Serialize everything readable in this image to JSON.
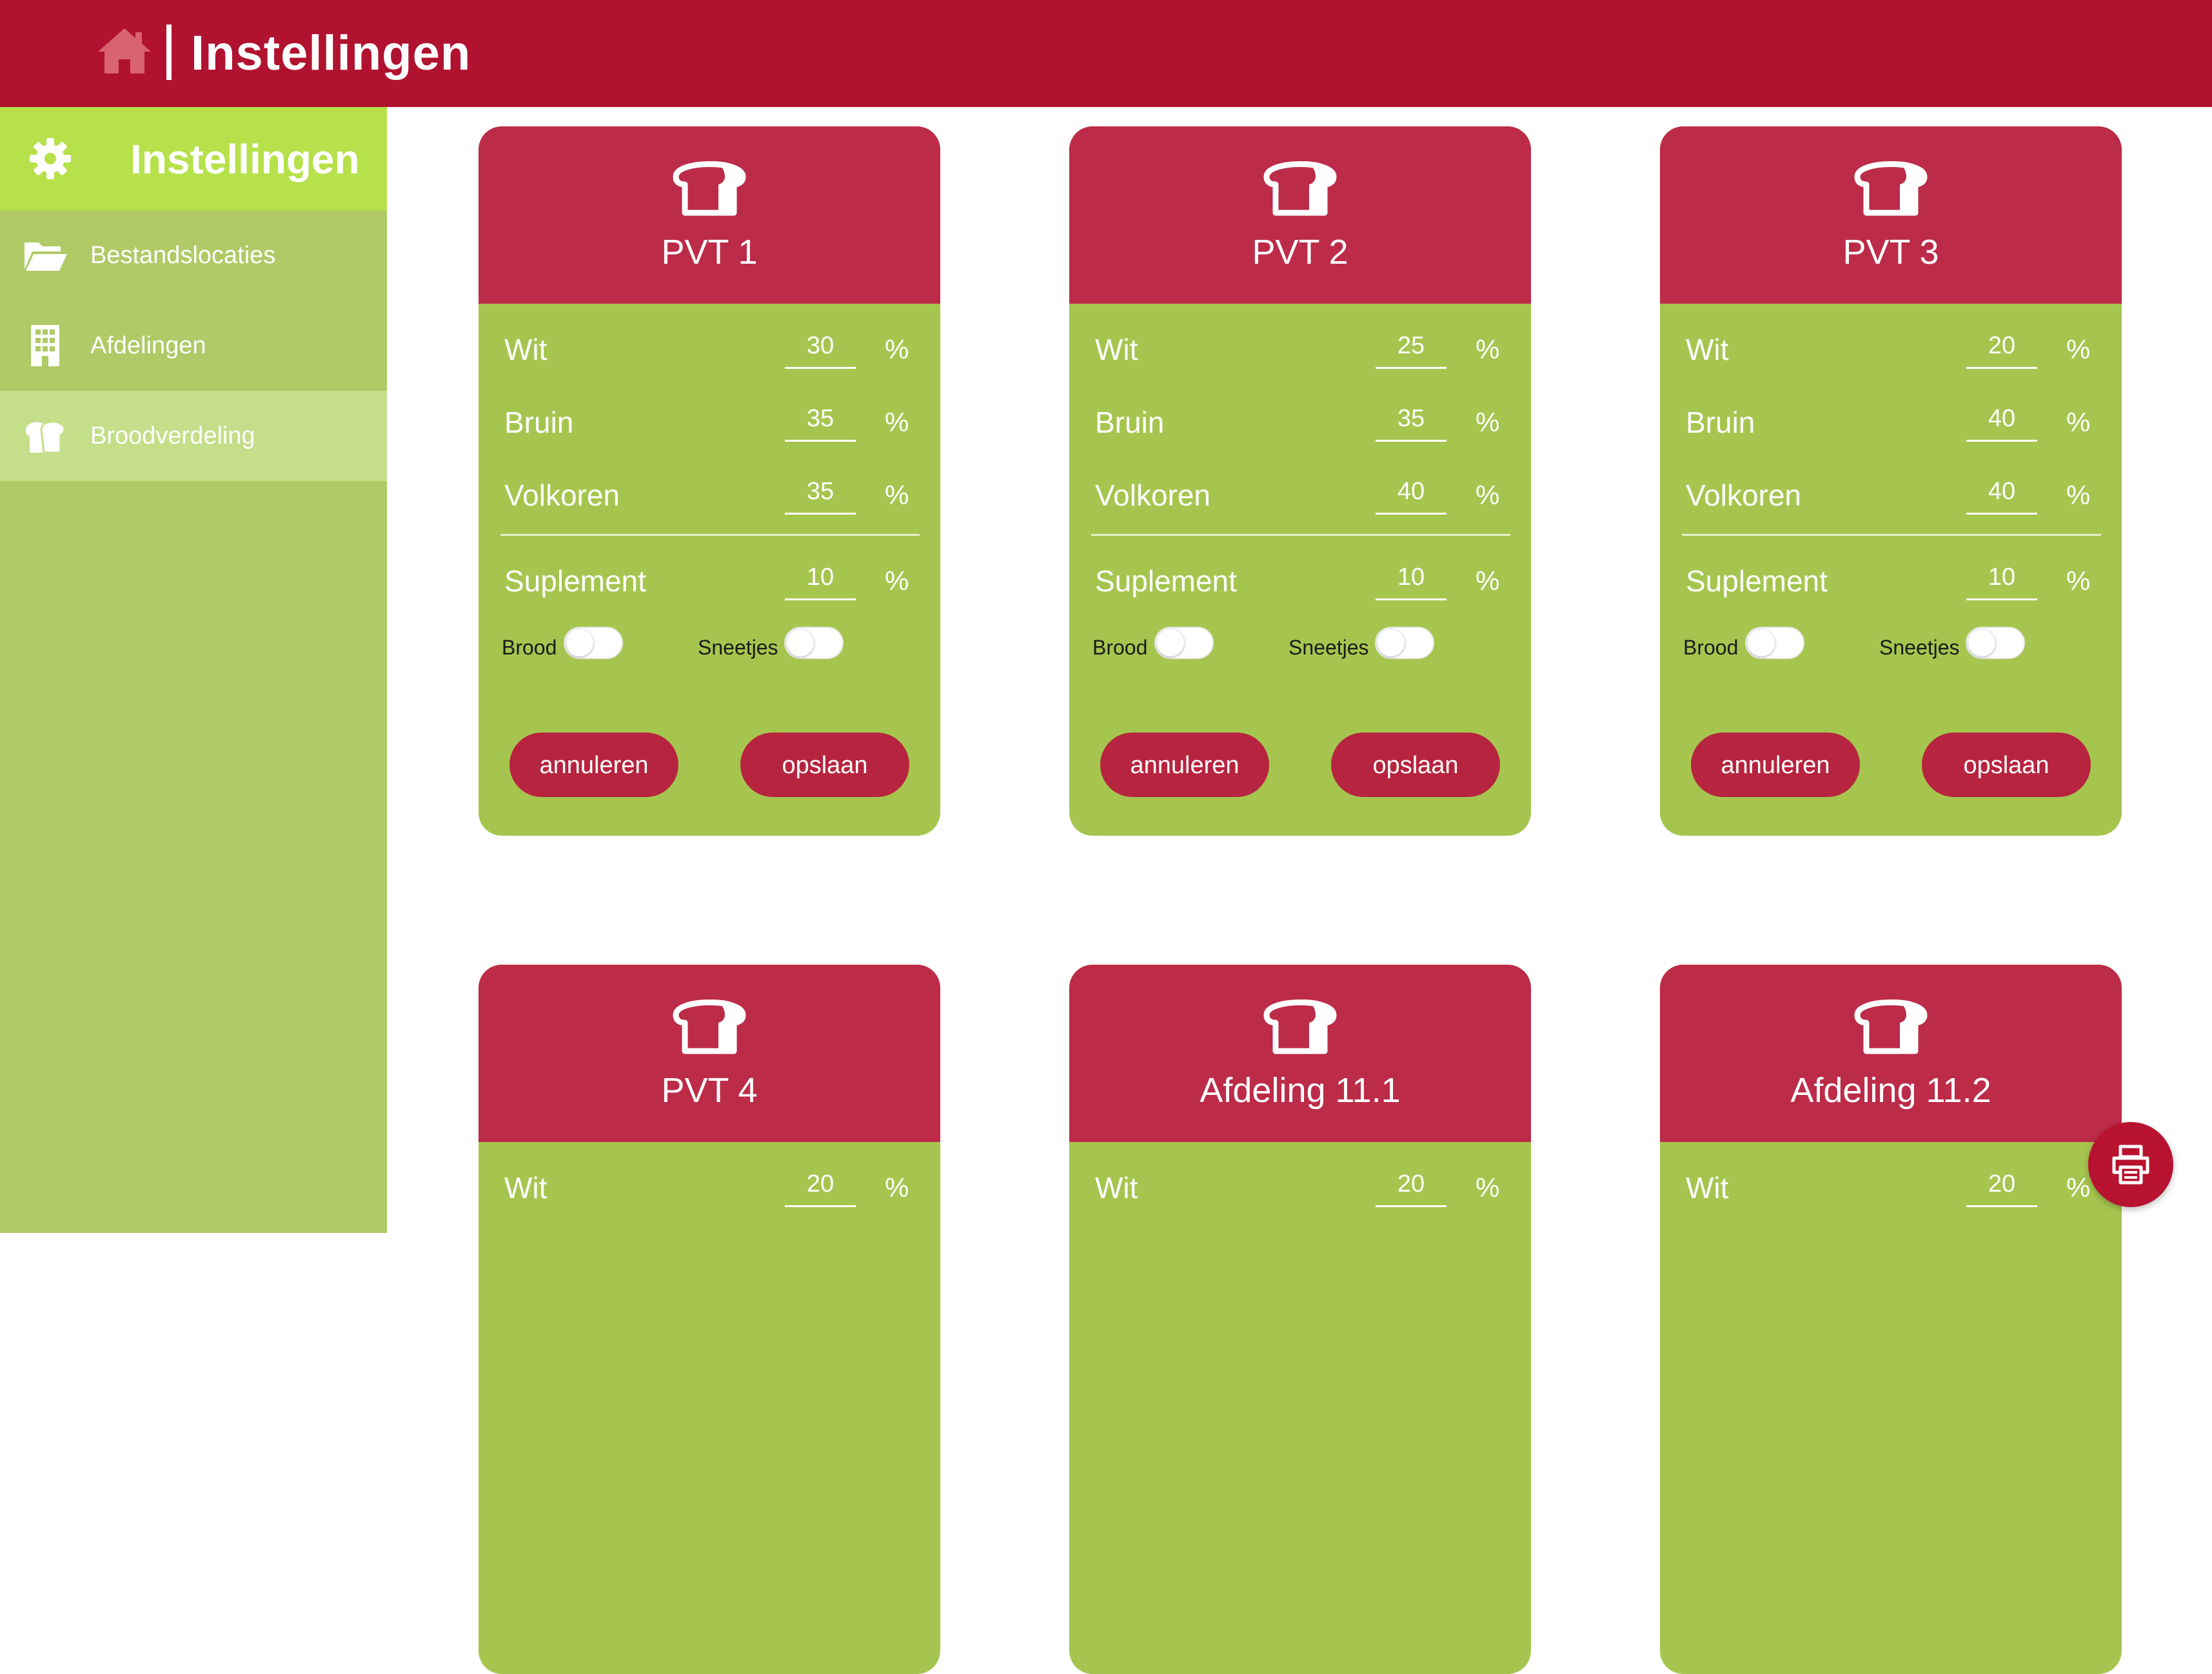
{
  "header": {
    "title": "Instellingen",
    "icon": "home-icon"
  },
  "sidebar": {
    "title": "Instellingen",
    "title_icon": "gear-icon",
    "items": [
      {
        "label": "Bestandslocaties",
        "icon": "folder-open-icon",
        "active": false
      },
      {
        "label": "Afdelingen",
        "icon": "building-icon",
        "active": false
      },
      {
        "label": "Broodverdeling",
        "icon": "bread-icon",
        "active": true
      }
    ]
  },
  "cards": [
    {
      "title": "PVT 1",
      "rows": [
        {
          "label": "Wit",
          "value": "30",
          "unit": "%"
        },
        {
          "label": "Bruin",
          "value": "35",
          "unit": "%"
        },
        {
          "label": "Volkoren",
          "value": "35",
          "unit": "%"
        },
        {
          "label": "Suplement",
          "value": "10",
          "unit": "%"
        }
      ],
      "toggles": [
        {
          "label": "Brood",
          "on": false
        },
        {
          "label": "Sneetjes",
          "on": false
        }
      ],
      "cancel_label": "annuleren",
      "save_label": "opslaan"
    },
    {
      "title": "PVT 2",
      "rows": [
        {
          "label": "Wit",
          "value": "25",
          "unit": "%"
        },
        {
          "label": "Bruin",
          "value": "35",
          "unit": "%"
        },
        {
          "label": "Volkoren",
          "value": "40",
          "unit": "%"
        },
        {
          "label": "Suplement",
          "value": "10",
          "unit": "%"
        }
      ],
      "toggles": [
        {
          "label": "Brood",
          "on": false
        },
        {
          "label": "Sneetjes",
          "on": false
        }
      ],
      "cancel_label": "annuleren",
      "save_label": "opslaan"
    },
    {
      "title": "PVT 3",
      "rows": [
        {
          "label": "Wit",
          "value": "20",
          "unit": "%"
        },
        {
          "label": "Bruin",
          "value": "40",
          "unit": "%"
        },
        {
          "label": "Volkoren",
          "value": "40",
          "unit": "%"
        },
        {
          "label": "Suplement",
          "value": "10",
          "unit": "%"
        }
      ],
      "toggles": [
        {
          "label": "Brood",
          "on": false
        },
        {
          "label": "Sneetjes",
          "on": false
        }
      ],
      "cancel_label": "annuleren",
      "save_label": "opslaan"
    },
    {
      "title": "PVT 4",
      "rows": [
        {
          "label": "Wit",
          "value": "20",
          "unit": "%"
        }
      ]
    },
    {
      "title": "Afdeling 11.1",
      "rows": [
        {
          "label": "Wit",
          "value": "20",
          "unit": "%"
        }
      ]
    },
    {
      "title": "Afdeling 11.2",
      "rows": [
        {
          "label": "Wit",
          "value": "20",
          "unit": "%"
        }
      ]
    }
  ],
  "fab": {
    "icon": "printer-icon"
  },
  "colors": {
    "topbar": "#b0122f",
    "sidebar": "#afca66",
    "sidebar_header": "#b6e14a",
    "sidebar_active": "#c5de8a",
    "card_head": "#bc2b48",
    "card_body": "#a6c54f",
    "button": "#b7243f"
  }
}
